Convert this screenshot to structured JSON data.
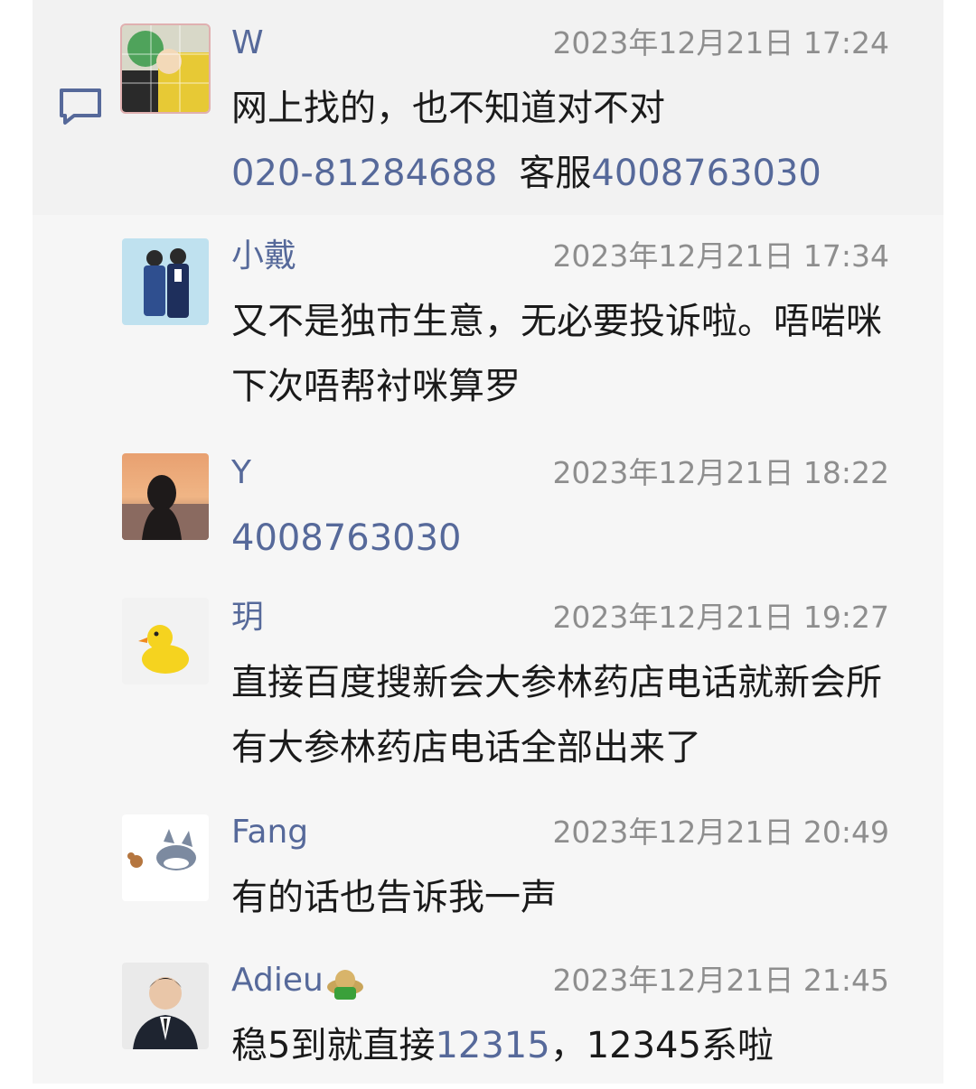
{
  "comments": [
    {
      "name": "W",
      "time": "2023年12月21日 17:24",
      "line1": "网上找的，也不知道对不对",
      "phone1": "020-81284688",
      "service_label": "客服",
      "phone2": "4008763030"
    },
    {
      "name": "小戴",
      "time": "2023年12月21日 17:34",
      "text": "又不是独市生意，无必要投诉啦。唔啱咪下次唔帮衬咪算罗"
    },
    {
      "name": "Y",
      "time": "2023年12月21日 18:22",
      "phone": "4008763030"
    },
    {
      "name": "玥",
      "time": "2023年12月21日 19:27",
      "text": "直接百度搜新会大参林药店电话就新会所有大参林药店电话全部出来了"
    },
    {
      "name": "Fang",
      "time": "2023年12月21日 20:49",
      "text": "有的话也告诉我一声"
    },
    {
      "name": "Adieu",
      "time": "2023年12月21日 21:45",
      "text_a": "稳5到就直接",
      "link": "12315",
      "text_b": "，12345系啦"
    }
  ],
  "colors": {
    "name": "#56699a",
    "time": "#8e8e8e",
    "text": "#1a1a1a",
    "background": "#f6f6f6"
  },
  "icons": [
    "comment-bubble-icon",
    "hat-emoji-icon"
  ]
}
